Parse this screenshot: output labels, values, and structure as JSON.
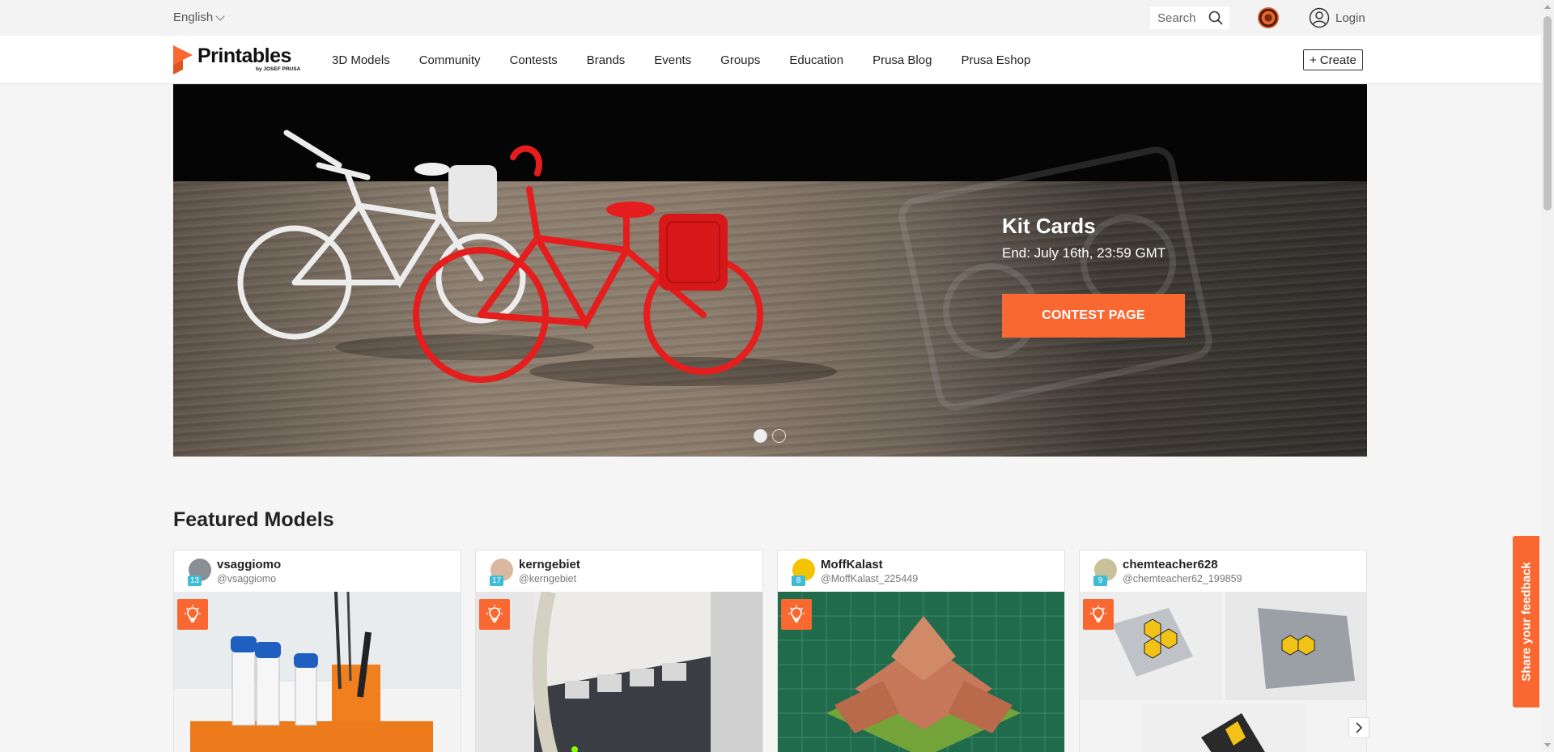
{
  "topbar": {
    "language": "English",
    "search_label": "Search",
    "login_label": "Login"
  },
  "brand": {
    "name": "Printables",
    "byline": "by JOSEF PRUSA",
    "accent": "#fa6831"
  },
  "nav": {
    "items": [
      {
        "label": "3D Models"
      },
      {
        "label": "Community"
      },
      {
        "label": "Contests"
      },
      {
        "label": "Brands"
      },
      {
        "label": "Events"
      },
      {
        "label": "Groups"
      },
      {
        "label": "Education"
      },
      {
        "label": "Prusa Blog"
      },
      {
        "label": "Prusa Eshop"
      }
    ],
    "create_label": "Create"
  },
  "hero": {
    "title": "Kit Cards",
    "subtitle": "End: July 16th, 23:59 GMT",
    "cta_label": "CONTEST PAGE",
    "slides_total": 2,
    "active_slide": 1
  },
  "featured": {
    "title": "Featured Models",
    "cards": [
      {
        "username": "vsaggiomo",
        "handle": "@vsaggiomo",
        "level": "13"
      },
      {
        "username": "kerngebiet",
        "handle": "@kerngebiet",
        "level": "17"
      },
      {
        "username": "MoffKalast",
        "handle": "@MoffKalast_225449",
        "level": "8"
      },
      {
        "username": "chemteacher628",
        "handle": "@chemteacher62_199859",
        "level": "9"
      }
    ]
  },
  "feedback": {
    "label": "Share your feedback"
  }
}
